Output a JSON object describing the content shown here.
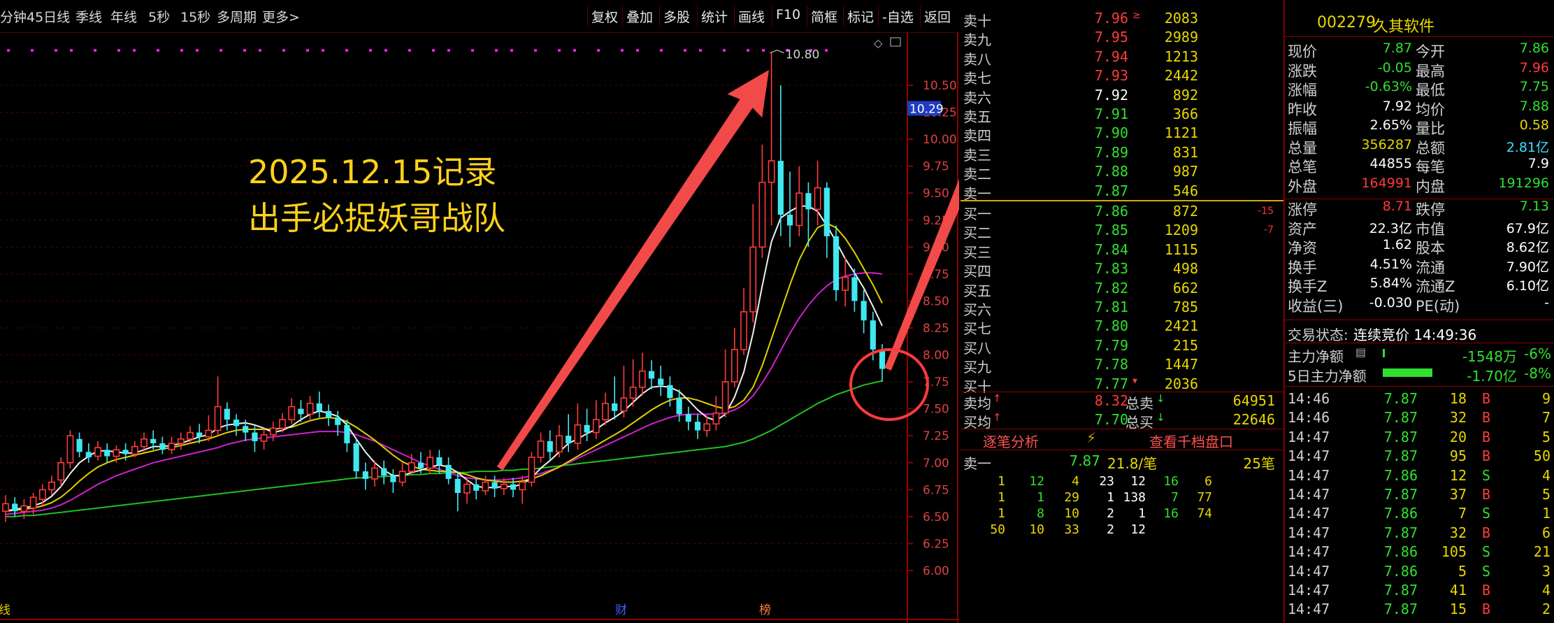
{
  "toolbar": {
    "left_tabs": [
      "分钟",
      "45日线",
      "季线",
      "年线",
      "5秒",
      "15秒",
      "多周期",
      "更多>"
    ],
    "right_buttons": [
      "复权",
      "叠加",
      "多股",
      "统计",
      "画线",
      "F10",
      "简框",
      "标记",
      "-自选",
      "返回"
    ]
  },
  "chart": {
    "y_ticks": [
      "10.50",
      "10.25",
      "10.00",
      "9.75",
      "9.50",
      "9.25",
      "9.00",
      "8.75",
      "8.50",
      "8.25",
      "8.00",
      "7.75",
      "7.50",
      "7.25",
      "7.00",
      "6.75",
      "6.50",
      "6.25",
      "6.00"
    ],
    "current_price_tag": "10.29",
    "high_label": "10.80",
    "annotation_line1": "2025.12.15记录",
    "annotation_line2": "出手必捉妖哥战队",
    "bottom_marker_cai": "财",
    "bottom_marker_bang": "榜",
    "bottom_marker_left": "线"
  },
  "chart_data": {
    "type": "candlestick",
    "ylim": [
      5.8,
      10.95
    ],
    "y_axis_ticks": [
      6.0,
      6.25,
      6.5,
      6.75,
      7.0,
      7.25,
      7.5,
      7.75,
      8.0,
      8.25,
      8.5,
      8.75,
      9.0,
      9.25,
      9.5,
      9.75,
      10.0,
      10.25,
      10.5
    ],
    "candles": [
      [
        6.55,
        6.62,
        6.45,
        6.7
      ],
      [
        6.62,
        6.55,
        6.5,
        6.68
      ],
      [
        6.55,
        6.6,
        6.48,
        6.66
      ],
      [
        6.58,
        6.68,
        6.52,
        6.72
      ],
      [
        6.66,
        6.75,
        6.6,
        6.8
      ],
      [
        6.75,
        6.82,
        6.7,
        6.88
      ],
      [
        6.84,
        7.0,
        6.78,
        7.05
      ],
      [
        7.0,
        7.25,
        6.95,
        7.3
      ],
      [
        7.22,
        7.1,
        7.05,
        7.28
      ],
      [
        7.1,
        7.05,
        7.0,
        7.18
      ],
      [
        7.06,
        7.14,
        7.02,
        7.2
      ],
      [
        7.12,
        7.06,
        7.0,
        7.18
      ],
      [
        7.06,
        7.12,
        7.0,
        7.16
      ],
      [
        7.12,
        7.08,
        7.02,
        7.18
      ],
      [
        7.08,
        7.15,
        7.05,
        7.2
      ],
      [
        7.15,
        7.22,
        7.1,
        7.28
      ],
      [
        7.22,
        7.18,
        7.12,
        7.3
      ],
      [
        7.18,
        7.12,
        7.08,
        7.24
      ],
      [
        7.12,
        7.18,
        7.08,
        7.24
      ],
      [
        7.18,
        7.22,
        7.12,
        7.28
      ],
      [
        7.22,
        7.28,
        7.18,
        7.34
      ],
      [
        7.28,
        7.24,
        7.18,
        7.36
      ],
      [
        7.24,
        7.3,
        7.2,
        7.44
      ],
      [
        7.3,
        7.52,
        7.26,
        7.8
      ],
      [
        7.5,
        7.4,
        7.3,
        7.56
      ],
      [
        7.4,
        7.34,
        7.25,
        7.45
      ],
      [
        7.34,
        7.28,
        7.2,
        7.4
      ],
      [
        7.28,
        7.2,
        7.1,
        7.34
      ],
      [
        7.2,
        7.26,
        7.12,
        7.32
      ],
      [
        7.26,
        7.32,
        7.2,
        7.38
      ],
      [
        7.32,
        7.4,
        7.28,
        7.46
      ],
      [
        7.4,
        7.52,
        7.36,
        7.6
      ],
      [
        7.5,
        7.45,
        7.38,
        7.58
      ],
      [
        7.45,
        7.55,
        7.4,
        7.62
      ],
      [
        7.55,
        7.48,
        7.42,
        7.66
      ],
      [
        7.48,
        7.42,
        7.34,
        7.54
      ],
      [
        7.42,
        7.35,
        7.25,
        7.48
      ],
      [
        7.35,
        7.18,
        7.1,
        7.4
      ],
      [
        7.18,
        6.92,
        6.85,
        7.22
      ],
      [
        6.92,
        6.85,
        6.75,
        7.0
      ],
      [
        6.85,
        6.95,
        6.78,
        7.02
      ],
      [
        6.95,
        6.88,
        6.8,
        7.02
      ],
      [
        6.88,
        6.82,
        6.72,
        6.94
      ],
      [
        6.82,
        6.92,
        6.78,
        7.0
      ],
      [
        6.92,
        7.0,
        6.88,
        7.08
      ],
      [
        7.0,
        6.95,
        6.9,
        7.1
      ],
      [
        6.95,
        7.05,
        6.9,
        7.12
      ],
      [
        7.05,
        6.98,
        6.9,
        7.12
      ],
      [
        6.98,
        6.85,
        6.8,
        7.05
      ],
      [
        6.85,
        6.72,
        6.55,
        6.92
      ],
      [
        6.72,
        6.8,
        6.62,
        6.86
      ],
      [
        6.8,
        6.74,
        6.66,
        6.86
      ],
      [
        6.74,
        6.82,
        6.7,
        6.88
      ],
      [
        6.82,
        6.76,
        6.68,
        6.88
      ],
      [
        6.76,
        6.8,
        6.7,
        6.86
      ],
      [
        6.8,
        6.75,
        6.68,
        6.86
      ],
      [
        6.75,
        6.82,
        6.62,
        6.88
      ],
      [
        6.82,
        7.05,
        6.78,
        7.1
      ],
      [
        7.05,
        7.2,
        7.0,
        7.28
      ],
      [
        7.2,
        7.1,
        7.02,
        7.3
      ],
      [
        7.1,
        7.25,
        7.05,
        7.35
      ],
      [
        7.25,
        7.18,
        7.1,
        7.45
      ],
      [
        7.18,
        7.35,
        7.12,
        7.55
      ],
      [
        7.35,
        7.28,
        7.2,
        7.5
      ],
      [
        7.28,
        7.4,
        7.22,
        7.58
      ],
      [
        7.4,
        7.55,
        7.35,
        7.65
      ],
      [
        7.55,
        7.48,
        7.4,
        7.8
      ],
      [
        7.48,
        7.6,
        7.42,
        7.9
      ],
      [
        7.6,
        7.7,
        7.52,
        7.96
      ],
      [
        7.7,
        7.85,
        7.62,
        8.02
      ],
      [
        7.85,
        7.78,
        7.68,
        7.95
      ],
      [
        7.78,
        7.72,
        7.62,
        7.9
      ],
      [
        7.72,
        7.6,
        7.52,
        7.8
      ],
      [
        7.6,
        7.45,
        7.38,
        7.68
      ],
      [
        7.45,
        7.38,
        7.3,
        7.52
      ],
      [
        7.38,
        7.3,
        7.22,
        7.45
      ],
      [
        7.3,
        7.36,
        7.24,
        7.44
      ],
      [
        7.36,
        7.46,
        7.3,
        7.62
      ],
      [
        7.46,
        7.75,
        7.42,
        8.05
      ],
      [
        7.75,
        8.05,
        7.7,
        8.25
      ],
      [
        8.05,
        8.4,
        8.0,
        8.62
      ],
      [
        8.4,
        9.0,
        8.3,
        9.4
      ],
      [
        9.0,
        9.6,
        8.9,
        9.95
      ],
      [
        9.6,
        9.8,
        9.2,
        10.8
      ],
      [
        9.8,
        9.3,
        9.1,
        10.5
      ],
      [
        9.3,
        9.2,
        9.0,
        9.7
      ],
      [
        9.2,
        9.5,
        9.1,
        9.75
      ],
      [
        9.5,
        9.35,
        9.0,
        9.6
      ],
      [
        9.35,
        9.55,
        9.2,
        9.8
      ],
      [
        9.55,
        9.1,
        8.9,
        9.6
      ],
      [
        9.1,
        8.6,
        8.5,
        9.2
      ],
      [
        8.6,
        8.72,
        8.45,
        8.9
      ],
      [
        8.72,
        8.5,
        8.4,
        8.8
      ],
      [
        8.5,
        8.32,
        8.2,
        8.6
      ],
      [
        8.32,
        8.05,
        7.95,
        8.4
      ],
      [
        8.05,
        7.87,
        7.75,
        8.1
      ]
    ],
    "ma_white": [
      6.55,
      6.57,
      6.58,
      6.6,
      6.63,
      6.69,
      6.78,
      6.9,
      7.0,
      7.06,
      7.11,
      7.11,
      7.1,
      7.09,
      7.09,
      7.12,
      7.15,
      7.15,
      7.16,
      7.18,
      7.21,
      7.24,
      7.26,
      7.32,
      7.35,
      7.36,
      7.37,
      7.35,
      7.32,
      7.28,
      7.3,
      7.34,
      7.4,
      7.45,
      7.48,
      7.46,
      7.43,
      7.35,
      7.22,
      7.1,
      7.0,
      6.93,
      6.88,
      6.88,
      6.91,
      6.93,
      6.96,
      6.98,
      6.96,
      6.91,
      6.84,
      6.78,
      6.77,
      6.77,
      6.78,
      6.78,
      6.8,
      6.86,
      6.95,
      7.02,
      7.1,
      7.18,
      7.22,
      7.27,
      7.31,
      7.37,
      7.42,
      7.48,
      7.56,
      7.64,
      7.7,
      7.71,
      7.7,
      7.66,
      7.58,
      7.49,
      7.42,
      7.39,
      7.45,
      7.61,
      7.84,
      8.2,
      8.64,
      9.05,
      9.27,
      9.33,
      9.38,
      9.38,
      9.33,
      9.2,
      9.05,
      8.89,
      8.76,
      8.62,
      8.45,
      8.27
    ],
    "ma_yellow": [
      6.55,
      6.56,
      6.57,
      6.58,
      6.6,
      6.63,
      6.68,
      6.75,
      6.83,
      6.9,
      6.96,
      7.0,
      7.03,
      7.05,
      7.07,
      7.09,
      7.11,
      7.13,
      7.14,
      7.16,
      7.18,
      7.2,
      7.22,
      7.25,
      7.28,
      7.3,
      7.31,
      7.31,
      7.31,
      7.31,
      7.32,
      7.33,
      7.36,
      7.39,
      7.41,
      7.42,
      7.41,
      7.38,
      7.33,
      7.27,
      7.21,
      7.14,
      7.07,
      7.01,
      6.97,
      6.94,
      6.93,
      6.92,
      6.92,
      6.91,
      6.89,
      6.86,
      6.84,
      6.83,
      6.82,
      6.82,
      6.83,
      6.85,
      6.88,
      6.92,
      6.96,
      7.01,
      7.06,
      7.11,
      7.16,
      7.21,
      7.26,
      7.31,
      7.37,
      7.43,
      7.49,
      7.54,
      7.58,
      7.6,
      7.6,
      7.58,
      7.55,
      7.52,
      7.5,
      7.52,
      7.58,
      7.7,
      7.9,
      8.15,
      8.4,
      8.65,
      8.88,
      9.05,
      9.18,
      9.22,
      9.18,
      9.08,
      8.95,
      8.8,
      8.65,
      8.48
    ],
    "ma_magenta": [
      6.52,
      6.53,
      6.54,
      6.55,
      6.56,
      6.58,
      6.61,
      6.65,
      6.7,
      6.75,
      6.8,
      6.84,
      6.88,
      6.91,
      6.94,
      6.97,
      7.0,
      7.02,
      7.04,
      7.06,
      7.08,
      7.1,
      7.12,
      7.14,
      7.17,
      7.19,
      7.21,
      7.22,
      7.23,
      7.24,
      7.25,
      7.26,
      7.27,
      7.28,
      7.29,
      7.29,
      7.29,
      7.28,
      7.26,
      7.23,
      7.2,
      7.16,
      7.12,
      7.08,
      7.04,
      7.0,
      6.97,
      6.94,
      6.91,
      6.88,
      6.86,
      6.85,
      6.84,
      6.84,
      6.84,
      6.85,
      6.86,
      6.88,
      6.9,
      6.93,
      6.96,
      7.0,
      7.04,
      7.08,
      7.12,
      7.16,
      7.2,
      7.24,
      7.28,
      7.32,
      7.36,
      7.39,
      7.42,
      7.44,
      7.45,
      7.45,
      7.45,
      7.45,
      7.46,
      7.49,
      7.54,
      7.62,
      7.74,
      7.88,
      8.04,
      8.2,
      8.34,
      8.46,
      8.56,
      8.64,
      8.7,
      8.73,
      8.75,
      8.76,
      8.76,
      8.75
    ],
    "ma_green": [
      6.5,
      6.5,
      6.51,
      6.51,
      6.52,
      6.53,
      6.54,
      6.55,
      6.56,
      6.57,
      6.58,
      6.59,
      6.6,
      6.61,
      6.62,
      6.63,
      6.64,
      6.65,
      6.66,
      6.67,
      6.68,
      6.69,
      6.7,
      6.71,
      6.72,
      6.73,
      6.74,
      6.75,
      6.76,
      6.77,
      6.78,
      6.79,
      6.8,
      6.81,
      6.82,
      6.83,
      6.84,
      6.85,
      6.86,
      6.86,
      6.87,
      6.87,
      6.88,
      6.88,
      6.89,
      6.89,
      6.9,
      6.9,
      6.91,
      6.91,
      6.91,
      6.92,
      6.92,
      6.92,
      6.93,
      6.93,
      6.94,
      6.94,
      6.95,
      6.96,
      6.97,
      6.98,
      6.99,
      7.0,
      7.01,
      7.02,
      7.03,
      7.04,
      7.05,
      7.06,
      7.07,
      7.08,
      7.09,
      7.1,
      7.11,
      7.12,
      7.13,
      7.14,
      7.15,
      7.17,
      7.19,
      7.22,
      7.26,
      7.3,
      7.35,
      7.4,
      7.45,
      7.5,
      7.55,
      7.59,
      7.63,
      7.66,
      7.69,
      7.72,
      7.74,
      7.76
    ]
  },
  "orderbook": {
    "asks": [
      {
        "label": "卖十",
        "price": "7.96",
        "vol": "2083",
        "flag": "≥"
      },
      {
        "label": "卖九",
        "price": "7.95",
        "vol": "2989"
      },
      {
        "label": "卖八",
        "price": "7.94",
        "vol": "1213"
      },
      {
        "label": "卖七",
        "price": "7.93",
        "vol": "2442"
      },
      {
        "label": "卖六",
        "price": "7.92",
        "vol": "892"
      },
      {
        "label": "卖五",
        "price": "7.91",
        "vol": "366"
      },
      {
        "label": "卖四",
        "price": "7.90",
        "vol": "1121"
      },
      {
        "label": "卖三",
        "price": "7.89",
        "vol": "831"
      },
      {
        "label": "卖二",
        "price": "7.88",
        "vol": "987"
      },
      {
        "label": "卖一",
        "price": "7.87",
        "vol": "546"
      }
    ],
    "bids": [
      {
        "label": "买一",
        "price": "7.86",
        "vol": "872",
        "chg": "-15"
      },
      {
        "label": "买二",
        "price": "7.85",
        "vol": "1209",
        "chg": "-7"
      },
      {
        "label": "买三",
        "price": "7.84",
        "vol": "1115"
      },
      {
        "label": "买四",
        "price": "7.83",
        "vol": "498"
      },
      {
        "label": "买五",
        "price": "7.82",
        "vol": "662"
      },
      {
        "label": "买六",
        "price": "7.81",
        "vol": "785"
      },
      {
        "label": "买七",
        "price": "7.80",
        "vol": "2421"
      },
      {
        "label": "买八",
        "price": "7.79",
        "vol": "215"
      },
      {
        "label": "买九",
        "price": "7.78",
        "vol": "1447"
      },
      {
        "label": "买十",
        "price": "7.77",
        "vol": "2036",
        "flag": "▾"
      }
    ],
    "avg_sell_label": "卖均",
    "avg_sell": "8.32",
    "total_sell_label": "总卖",
    "total_sell": "64951",
    "avg_buy_label": "买均",
    "avg_buy": "7.70",
    "total_buy_label": "总买",
    "total_buy": "22646",
    "tick_analysis": "逐笔分析",
    "view_thousand": "查看千档盘口",
    "sell1_label": "卖一",
    "sell1_price": "7.87",
    "sell1_amount": "21.8/笔",
    "sell1_count": "25笔",
    "queue_rows": [
      [
        "1",
        "12",
        "4",
        "23",
        "12",
        "16",
        "6"
      ],
      [
        "1",
        "1",
        "29",
        "1",
        "138",
        "7",
        "77"
      ],
      [
        "1",
        "8",
        "10",
        "2",
        "1",
        "16",
        "74"
      ],
      [
        "50",
        "10",
        "33",
        "2",
        "12",
        "",
        ""
      ]
    ]
  },
  "quote": {
    "code": "002279",
    "name": "久其软件",
    "rows": [
      {
        "k1": "现价",
        "v1": "7.87",
        "c1": "green",
        "k2": "今开",
        "v2": "7.86",
        "c2": "green"
      },
      {
        "k1": "涨跌",
        "v1": "-0.05",
        "c1": "green",
        "k2": "最高",
        "v2": "7.96",
        "c2": "red"
      },
      {
        "k1": "涨幅",
        "v1": "-0.63%",
        "c1": "green",
        "k2": "最低",
        "v2": "7.75",
        "c2": "green"
      },
      {
        "k1": "昨收",
        "v1": "7.92",
        "c1": "white",
        "k2": "均价",
        "v2": "7.88",
        "c2": "green"
      },
      {
        "k1": "振幅",
        "v1": "2.65%",
        "c1": "white",
        "k2": "量比",
        "v2": "0.58",
        "c2": "yellow"
      },
      {
        "k1": "总量",
        "v1": "356287",
        "c1": "yellow",
        "k2": "总额",
        "v2": "2.81亿",
        "c2": "cyan"
      },
      {
        "k1": "总笔",
        "v1": "44855",
        "c1": "white",
        "k2": "每笔",
        "v2": "7.9",
        "c2": "white"
      },
      {
        "k1": "外盘",
        "v1": "164991",
        "c1": "red",
        "k2": "内盘",
        "v2": "191296",
        "c2": "green"
      },
      {
        "k1": "涨停",
        "v1": "8.71",
        "c1": "red",
        "k2": "跌停",
        "v2": "7.13",
        "c2": "green"
      },
      {
        "k1": "资产",
        "v1": "22.3亿",
        "c1": "white",
        "k2": "市值",
        "v2": "67.9亿",
        "c2": "white"
      },
      {
        "k1": "净资",
        "v1": "1.62",
        "c1": "white",
        "k2": "股本",
        "v2": "8.62亿",
        "c2": "white"
      },
      {
        "k1": "换手",
        "v1": "4.51%",
        "c1": "white",
        "k2": "流通",
        "v2": "7.90亿",
        "c2": "white"
      },
      {
        "k1": "换手Z",
        "v1": "5.84%",
        "c1": "white",
        "k2": "流通Z",
        "v2": "6.10亿",
        "c2": "white"
      },
      {
        "k1": "收益(三)",
        "v1": "-0.030",
        "c1": "white",
        "k2": "PE(动)",
        "v2": "-",
        "c2": "white"
      }
    ],
    "status_label": "交易状态:",
    "status_value": "连续竞价 14:49:36",
    "main_net_label": "主力净额",
    "main_net_value": "-1548万",
    "main_net_pct": "-6%",
    "five_day_label": "5日主力净额",
    "five_day_value": "-1.70亿",
    "five_day_pct": "-8%",
    "main_net_fill": 0.03,
    "five_day_fill": 0.75
  },
  "trades": [
    [
      "14:46",
      "7.87",
      "18",
      "B",
      "9"
    ],
    [
      "14:46",
      "7.87",
      "32",
      "B",
      "7"
    ],
    [
      "14:47",
      "7.87",
      "20",
      "B",
      "5"
    ],
    [
      "14:47",
      "7.87",
      "95",
      "B",
      "50"
    ],
    [
      "14:47",
      "7.86",
      "12",
      "S",
      "4"
    ],
    [
      "14:47",
      "7.87",
      "37",
      "B",
      "5"
    ],
    [
      "14:47",
      "7.86",
      "7",
      "S",
      "1"
    ],
    [
      "14:47",
      "7.87",
      "32",
      "B",
      "6"
    ],
    [
      "14:47",
      "7.86",
      "105",
      "S",
      "21"
    ],
    [
      "14:47",
      "7.86",
      "5",
      "S",
      "3"
    ],
    [
      "14:47",
      "7.87",
      "41",
      "B",
      "4"
    ],
    [
      "14:47",
      "7.87",
      "15",
      "B",
      "2"
    ]
  ],
  "colors": {
    "up": "#ff3a3a",
    "down": "#40e8f0",
    "frame": "#8b0000",
    "arrow": "#ff4d4d",
    "annotation": "#ffd21a"
  }
}
